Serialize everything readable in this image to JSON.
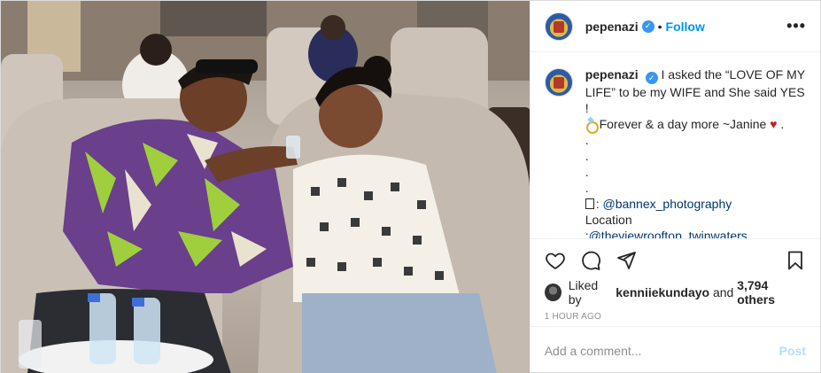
{
  "header": {
    "username": "pepenazi",
    "separator": "•",
    "follow_label": "Follow",
    "more_label": "•••"
  },
  "caption": {
    "username": "pepenazi",
    "text_line1": "I asked the “LOVE OF MY LIFE” to be my WIFE and She said YES !",
    "text_line2": "Forever & a day more ~Janine",
    "heart": "♥",
    "line2_end": ".",
    "dots": [
      ".",
      ".",
      ".",
      "."
    ],
    "photo_credit": "@bannex_photography",
    "location_label": "Location",
    "location_prefix": ":",
    "location_handle": "@theviewrooftop_twinwaters"
  },
  "likes": {
    "prefix": "Liked by",
    "user": "kenniiekundayo",
    "and": "and",
    "others": "3,794 others"
  },
  "time": "1 HOUR AGO",
  "comment": {
    "placeholder": "Add a comment...",
    "post_label": "Post"
  },
  "colors": {
    "accent": "#0095f6",
    "verified": "#3897f0",
    "muted": "#8e8e8e",
    "heart": "#c81e1e"
  }
}
